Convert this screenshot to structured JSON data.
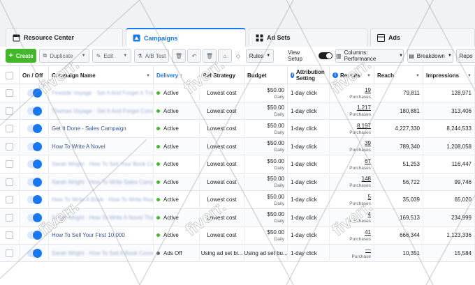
{
  "tabs": [
    {
      "label": "Resource Center",
      "icon": "resource-center-icon"
    },
    {
      "label": "Campaigns",
      "icon": "campaigns-icon"
    },
    {
      "label": "Ad Sets",
      "icon": "ad-sets-icon"
    },
    {
      "label": "Ads",
      "icon": "ads-icon"
    }
  ],
  "toolbar": {
    "create": "Create",
    "duplicate": "Duplicate",
    "edit": "Edit",
    "ab_test": "A/B Test",
    "rules": "Rules",
    "view_setup": "View Setup",
    "columns": "Columns: Performance",
    "breakdown": "Breakdown",
    "reports": "Repo"
  },
  "columns": {
    "on_off": "On / Off",
    "name": "Campaign Name",
    "delivery": "Delivery ↑",
    "bid": "Bid Strategy",
    "budget": "Budget",
    "attribution": "Attribution Setting",
    "results": "Results",
    "reach": "Reach",
    "impressions": "Impressions"
  },
  "rows": [
    {
      "name": "Fireside Voyage · Set It And Forget It Traffic",
      "blur": true,
      "delivery": "Active",
      "bid": "Lowest cost",
      "budget": "$50.00",
      "budget_sub": "Daily",
      "attribution": "1-day click",
      "results": "19",
      "results_sub": "Purchases",
      "reach": "79,811",
      "impressions": "128,971"
    },
    {
      "name": "Thomas Voyage · Set It And Forget Conversions",
      "blur": true,
      "delivery": "Active",
      "bid": "Lowest cost",
      "budget": "$50.00",
      "budget_sub": "Daily",
      "attribution": "1-day click",
      "results": "1,217",
      "results_sub": "Purchases",
      "reach": "180,881",
      "impressions": "313,406"
    },
    {
      "name": "Get It Done - Sales Campaign",
      "blur": false,
      "delivery": "Active",
      "bid": "Lowest cost",
      "budget": "$50.00",
      "budget_sub": "Daily",
      "attribution": "1-day click",
      "results": "8,197",
      "results_sub": "Purchases",
      "reach": "4,227,330",
      "impressions": "8,244,533"
    },
    {
      "name": "How To Write A Novel",
      "blur": false,
      "delivery": "Active",
      "bid": "Lowest cost",
      "budget": "$50.00",
      "budget_sub": "Daily",
      "attribution": "1-day click",
      "results": "39",
      "results_sub": "Purchases",
      "reach": "789,340",
      "impressions": "1,208,058"
    },
    {
      "name": "Sarah Wright · How To Sell Your Book Campaign",
      "blur": true,
      "delivery": "Active",
      "bid": "Lowest cost",
      "budget": "$50.00",
      "budget_sub": "Daily",
      "attribution": "1-day click",
      "results": "67",
      "results_sub": "Purchases",
      "reach": "51,253",
      "impressions": "116,447"
    },
    {
      "name": "Sarah Wright · How To Write Sales Campaign",
      "blur": true,
      "delivery": "Active",
      "bid": "Lowest cost",
      "budget": "$50.00",
      "budget_sub": "Daily",
      "attribution": "1-day click",
      "results": "148",
      "results_sub": "Purchases",
      "reach": "56,722",
      "impressions": "99,746"
    },
    {
      "name": "How To Write A Book · How To Write Readers",
      "blur": true,
      "delivery": "Active",
      "bid": "Lowest cost",
      "budget": "$50.00",
      "budget_sub": "Daily",
      "attribution": "1-day click",
      "results": "5",
      "results_sub": "Purchases",
      "reach": "35,039",
      "impressions": "65,020"
    },
    {
      "name": "Sarah Wright · How To Write A Novel That Sells",
      "blur": true,
      "delivery": "Active",
      "bid": "Lowest cost",
      "budget": "$50.00",
      "budget_sub": "Daily",
      "attribution": "1-day click",
      "results": "4",
      "results_sub": "Purchases",
      "reach": "169,513",
      "impressions": "234,999"
    },
    {
      "name": "How To Sell Your First 10,000",
      "blur": false,
      "delivery": "Active",
      "bid": "Lowest cost",
      "budget": "$50.00",
      "budget_sub": "Daily",
      "attribution": "1-day click",
      "results": "41",
      "results_sub": "Purchases",
      "reach": "666,344",
      "impressions": "1,123,336"
    },
    {
      "name": "Sarah Wright · How To Sell A Book Conversions",
      "blur": true,
      "delivery": "Ads Off",
      "bid": "Using ad set bi...",
      "budget": "Using ad set bu...",
      "budget_sub": "",
      "attribution": "1-day click",
      "results": "—",
      "results_sub": "Purchase",
      "reach": "10,351",
      "impressions": "15,584"
    }
  ],
  "watermark": "fiverr."
}
